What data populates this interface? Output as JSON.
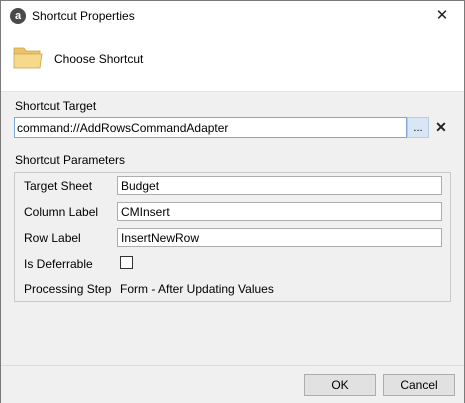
{
  "window": {
    "title": "Shortcut Properties",
    "app_icon_letter": "a",
    "close_glyph": "✕"
  },
  "header": {
    "icon": "folder-icon",
    "label": "Choose Shortcut",
    "icon_color": "#f5d78e"
  },
  "target": {
    "section_label": "Shortcut Target",
    "value": "command://AddRowsCommandAdapter",
    "browse_label": "...",
    "clear_glyph": "✕",
    "focus_color": "#7aa7d8"
  },
  "parameters": {
    "section_label": "Shortcut Parameters",
    "target_sheet": {
      "label": "Target Sheet",
      "value": "Budget"
    },
    "column_label": {
      "label": "Column Label",
      "value": "CMInsert"
    },
    "row_label": {
      "label": "Row Label",
      "value": "InsertNewRow"
    },
    "is_deferrable": {
      "label": "Is Deferrable",
      "checked": false
    },
    "processing_step": {
      "label": "Processing Step",
      "value": "Form - After Updating Values"
    }
  },
  "footer": {
    "ok_label": "OK",
    "cancel_label": "Cancel"
  }
}
